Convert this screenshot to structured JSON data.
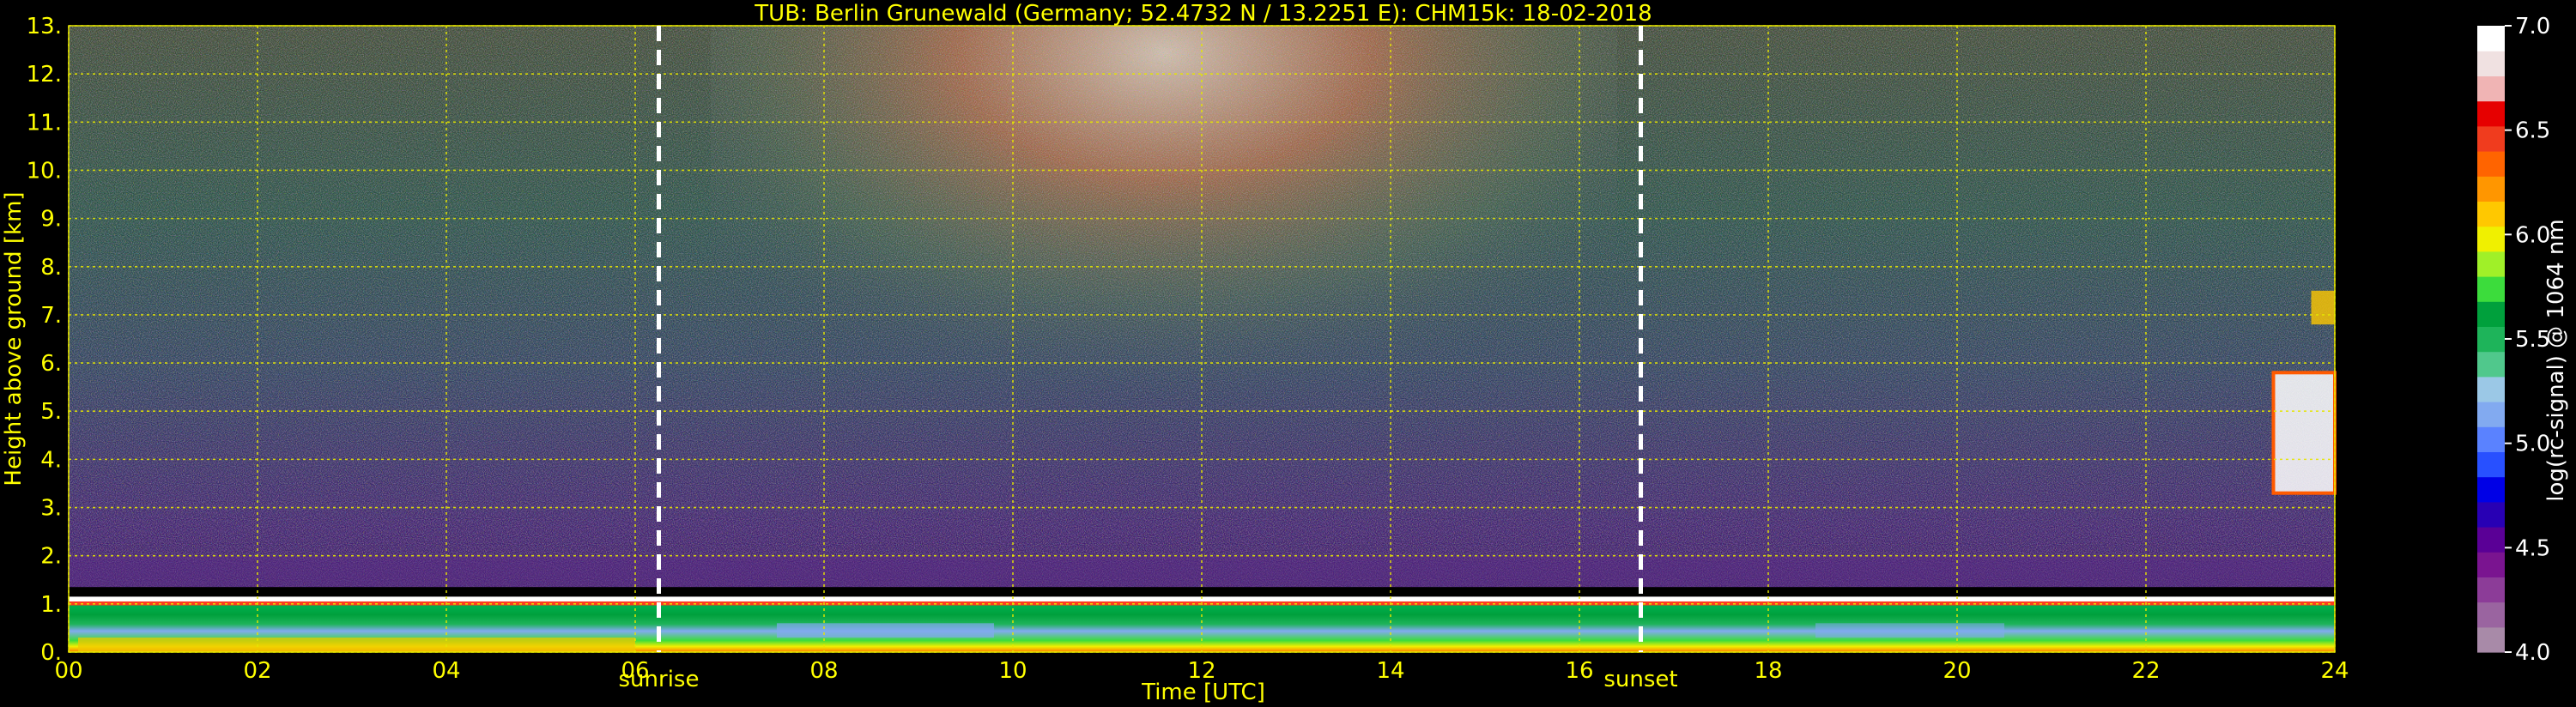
{
  "chart_data": {
    "type": "heatmap",
    "title": "TUB: Berlin Grunewald (Germany; 52.4732 N / 13.2251 E):    CHM15k: 18-02-2018",
    "xlabel": "Time [UTC]",
    "ylabel": "Height above ground [km]",
    "xlim": [
      0,
      24
    ],
    "ylim": [
      0,
      13
    ],
    "x_ticks": [
      0,
      2,
      4,
      6,
      8,
      10,
      12,
      14,
      16,
      18,
      20,
      22,
      24
    ],
    "x_tick_labels": [
      "00",
      "02",
      "04",
      "06",
      "08",
      "10",
      "12",
      "14",
      "16",
      "18",
      "20",
      "22",
      "24"
    ],
    "y_ticks": [
      0,
      1,
      2,
      3,
      4,
      5,
      6,
      7,
      8,
      9,
      10,
      11,
      12,
      13
    ],
    "y_tick_labels": [
      "0.",
      "1.",
      "2.",
      "3.",
      "4.",
      "5.",
      "6.",
      "7.",
      "8.",
      "9.",
      "10.",
      "11.",
      "12.",
      "13."
    ],
    "grid": true,
    "colorbar": {
      "label": "log(rc-signal) @ 1064 nm",
      "range": [
        4.0,
        7.0
      ],
      "ticks": [
        4.0,
        4.5,
        5.0,
        5.5,
        6.0,
        6.5,
        7.0
      ],
      "tick_labels": [
        "4.0",
        "4.5",
        "5.0",
        "5.5",
        "6.0",
        "6.5",
        "7.0"
      ],
      "colors": [
        "#a88aa8",
        "#9a64a0",
        "#8c3c98",
        "#7a1490",
        "#5a0096",
        "#2800b4",
        "#0000e6",
        "#2850ff",
        "#5a82ff",
        "#82aaf0",
        "#9bc8e6",
        "#50c88c",
        "#1eb45a",
        "#00a03c",
        "#3cdc3c",
        "#a0f028",
        "#f0f000",
        "#ffc800",
        "#ff9600",
        "#ff6400",
        "#f03c1e",
        "#e60000",
        "#f0b4b4",
        "#f0e1e1",
        "#ffffff"
      ]
    },
    "events": [
      {
        "label": "sunrise",
        "time": 6.25
      },
      {
        "label": "sunset",
        "time": 16.65
      }
    ]
  }
}
